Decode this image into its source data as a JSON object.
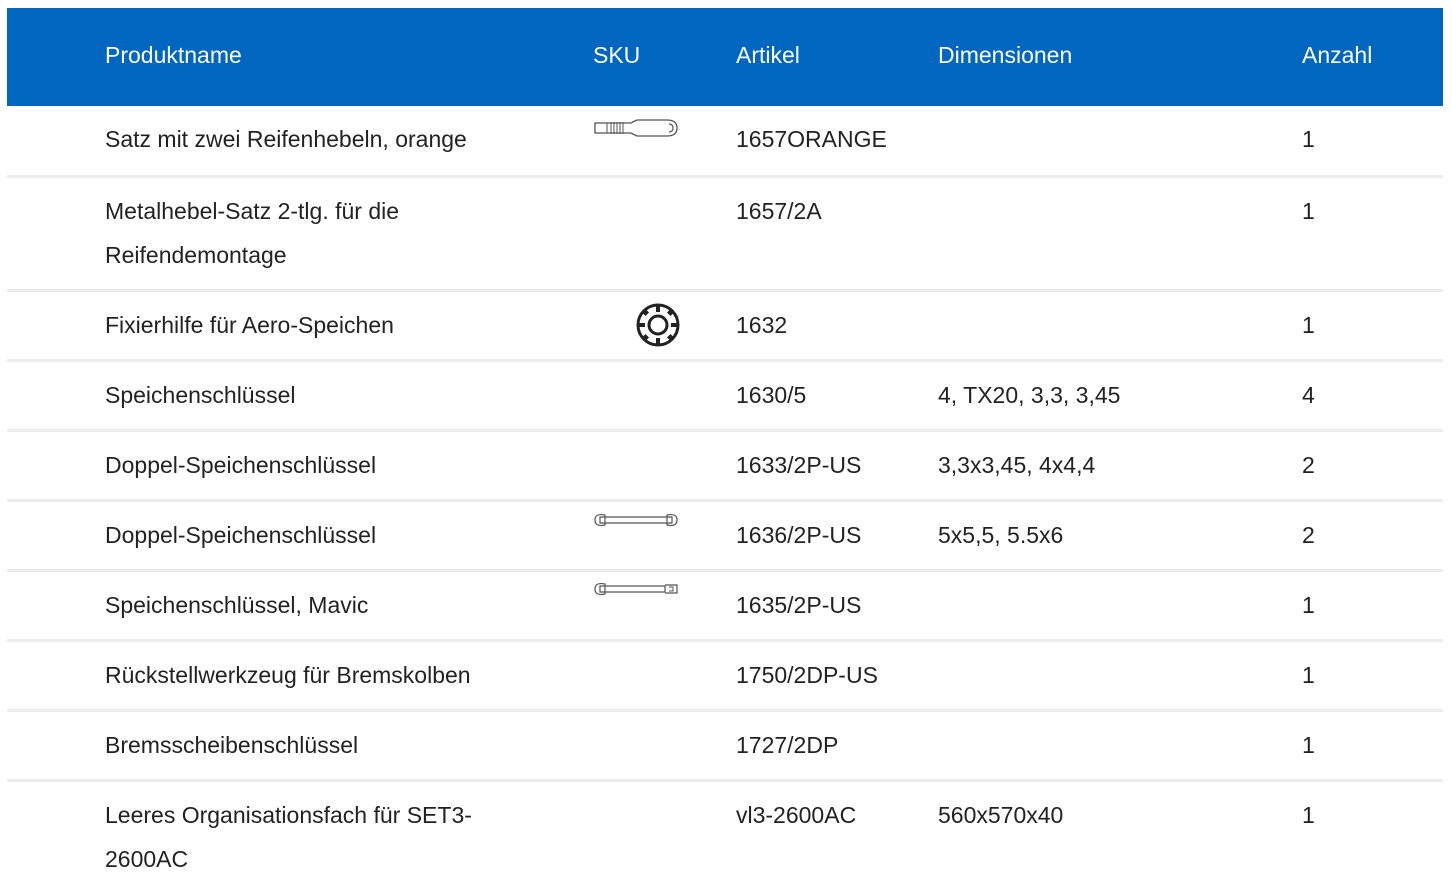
{
  "colors": {
    "header_background": "#0066bf",
    "header_text": "#ffffff",
    "row_divider": "#ececec",
    "body_text": "#222222"
  },
  "header": {
    "name": "Produktname",
    "sku": "SKU",
    "article": "Artikel",
    "dimensions": "Dimensionen",
    "quantity": "Anzahl"
  },
  "rows": [
    {
      "name": "Satz mit zwei Reifenhebeln, orange",
      "sku_icon": "tire-lever-icon",
      "article": "1657ORANGE",
      "dimensions": "",
      "quantity": "1"
    },
    {
      "name": "Metalhebel-Satz 2-tlg. für die Reifendemontage",
      "sku_icon": "",
      "article": "1657/2A",
      "dimensions": "",
      "quantity": "1"
    },
    {
      "name": "Fixierhilfe für Aero-Speichen",
      "sku_icon": "aero-spoke-holder-icon",
      "article": "1632",
      "dimensions": "",
      "quantity": "1"
    },
    {
      "name": "Speichenschlüssel",
      "sku_icon": "",
      "article": "1630/5",
      "dimensions": "4, TX20, 3,3, 3,45",
      "quantity": "4"
    },
    {
      "name": "Doppel-Speichenschlüssel",
      "sku_icon": "",
      "article": "1633/2P-US",
      "dimensions": "3,3x3,45, 4x4,4",
      "quantity": "2"
    },
    {
      "name": "Doppel-Speichenschlüssel",
      "sku_icon": "double-spoke-wrench-icon",
      "article": "1636/2P-US",
      "dimensions": "5x5,5, 5.5x6",
      "quantity": "2"
    },
    {
      "name": "Speichenschlüssel, Mavic",
      "sku_icon": "mavic-spoke-wrench-icon",
      "article": "1635/2P-US",
      "dimensions": "",
      "quantity": "1"
    },
    {
      "name": "Rückstellwerkzeug für Bremskolben",
      "sku_icon": "",
      "article": "1750/2DP-US",
      "dimensions": "",
      "quantity": "1"
    },
    {
      "name": "Bremsscheibenschlüssel",
      "sku_icon": "",
      "article": "1727/2DP",
      "dimensions": "",
      "quantity": "1"
    },
    {
      "name": "Leeres Organisationsfach für SET3-2600AC",
      "sku_icon": "",
      "article": "vl3-2600AC",
      "dimensions": "560x570x40",
      "quantity": "1"
    }
  ]
}
